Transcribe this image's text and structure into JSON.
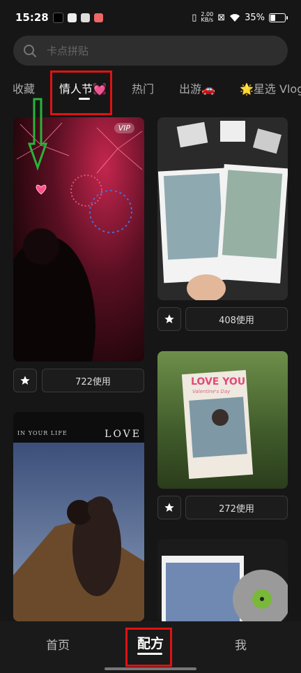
{
  "status_bar": {
    "time": "15:28",
    "net_speed_value": "2.00",
    "net_speed_unit": "KB/s",
    "battery": "35%"
  },
  "search": {
    "placeholder": "卡点拼贴",
    "icon": "search-icon"
  },
  "tabs": [
    {
      "label": "收藏",
      "active": false
    },
    {
      "label": "情人节💓",
      "active": true
    },
    {
      "label": "热门",
      "active": false
    },
    {
      "label": "出游🚗",
      "active": false
    },
    {
      "label": "🌟星选 Vlog",
      "active": false
    }
  ],
  "cards": [
    {
      "id": "fireworks",
      "vip_badge": "VIP",
      "usage": "722使用"
    },
    {
      "id": "polaroid-photos",
      "usage": "408使用"
    },
    {
      "id": "love-you-frame",
      "frame_text": "LOVE YOU",
      "frame_subtext": "Valentine's Day",
      "usage": "272使用"
    },
    {
      "id": "love-couple",
      "header_left": "IN YOUR LIFE",
      "header_right": "LOVE"
    },
    {
      "id": "vinyl-polaroid"
    }
  ],
  "bottom_nav": [
    {
      "label": "首页",
      "active": false
    },
    {
      "label": "配方",
      "active": true
    },
    {
      "label": "我",
      "active": false
    }
  ],
  "colors": {
    "background": "#161616",
    "annotation_red": "#e01212",
    "annotation_green": "#27b53a"
  }
}
